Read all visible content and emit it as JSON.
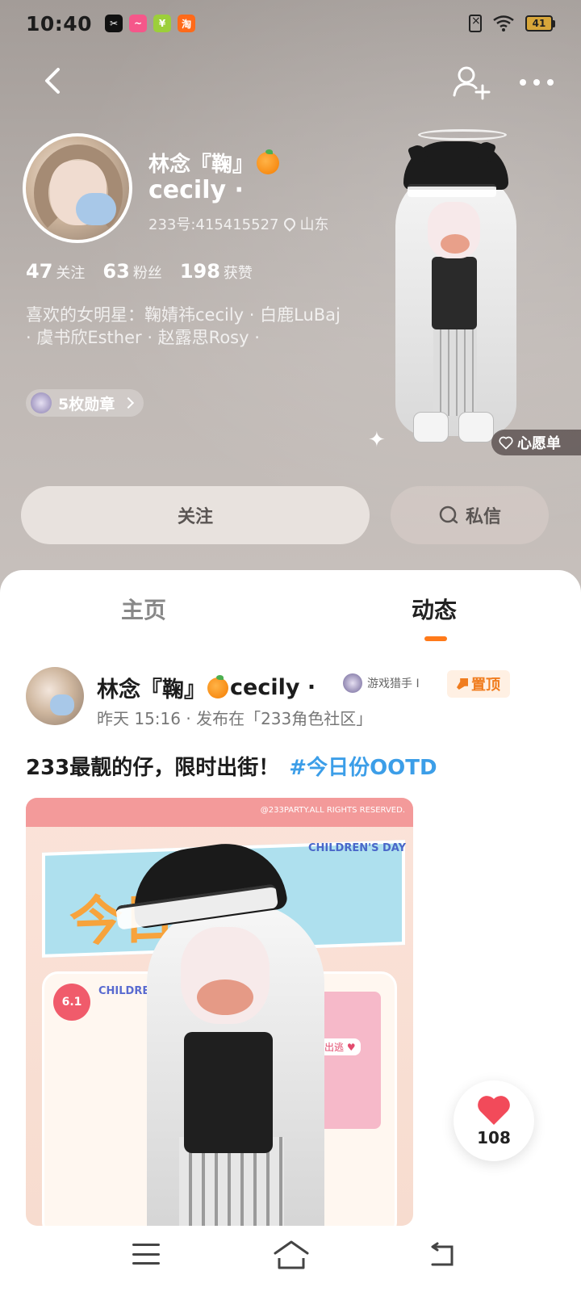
{
  "status_bar": {
    "time": "10:40",
    "battery": "41",
    "app_icons": [
      "capcut-icon",
      "weibo-icon",
      "wechat-pay-icon",
      "taobao-icon"
    ]
  },
  "profile": {
    "name_line1": "林念『鞠』",
    "name_line2": "cecily ·",
    "user_id": "233号:415415527",
    "location": "山东",
    "stats": [
      {
        "value": "47",
        "label": "关注"
      },
      {
        "value": "63",
        "label": "粉丝"
      },
      {
        "value": "198",
        "label": "获赞"
      }
    ],
    "bio": "喜欢的女明星：鞠婧祎cecily · 白鹿LuBaj · 虞书欣Esther · 赵露思Rosy ·",
    "medals": "5枚勋章",
    "wishlist": "心愿单"
  },
  "actions": {
    "follow": "关注",
    "message": "私信"
  },
  "tabs": [
    {
      "label": "主页",
      "active": false
    },
    {
      "label": "动态",
      "active": true
    }
  ],
  "post": {
    "author_name": "林念『鞠』",
    "author_suffix": "cecily ·",
    "badge": "游戏猎手 I",
    "pinned": "置顶",
    "meta": "昨天 15:16 · 发布在「233角色社区」",
    "text": "233最靓的仔，限时出街！",
    "hashtag": "#今日份OOTD",
    "image": {
      "copyright": "@233PARTY.ALL RIGHTS RESERVED.",
      "banner": "今日份！",
      "childrens_day": "CHILDREN'S DAY",
      "date": "6.1",
      "ootd": "CHILDREN'S DAY OOTD",
      "dream": "梦幻出逃 ♥"
    },
    "likes": "108"
  },
  "colors": {
    "accent": "#ff7a1a",
    "hashtag": "#3c9ee8",
    "like": "#f24a5a"
  }
}
